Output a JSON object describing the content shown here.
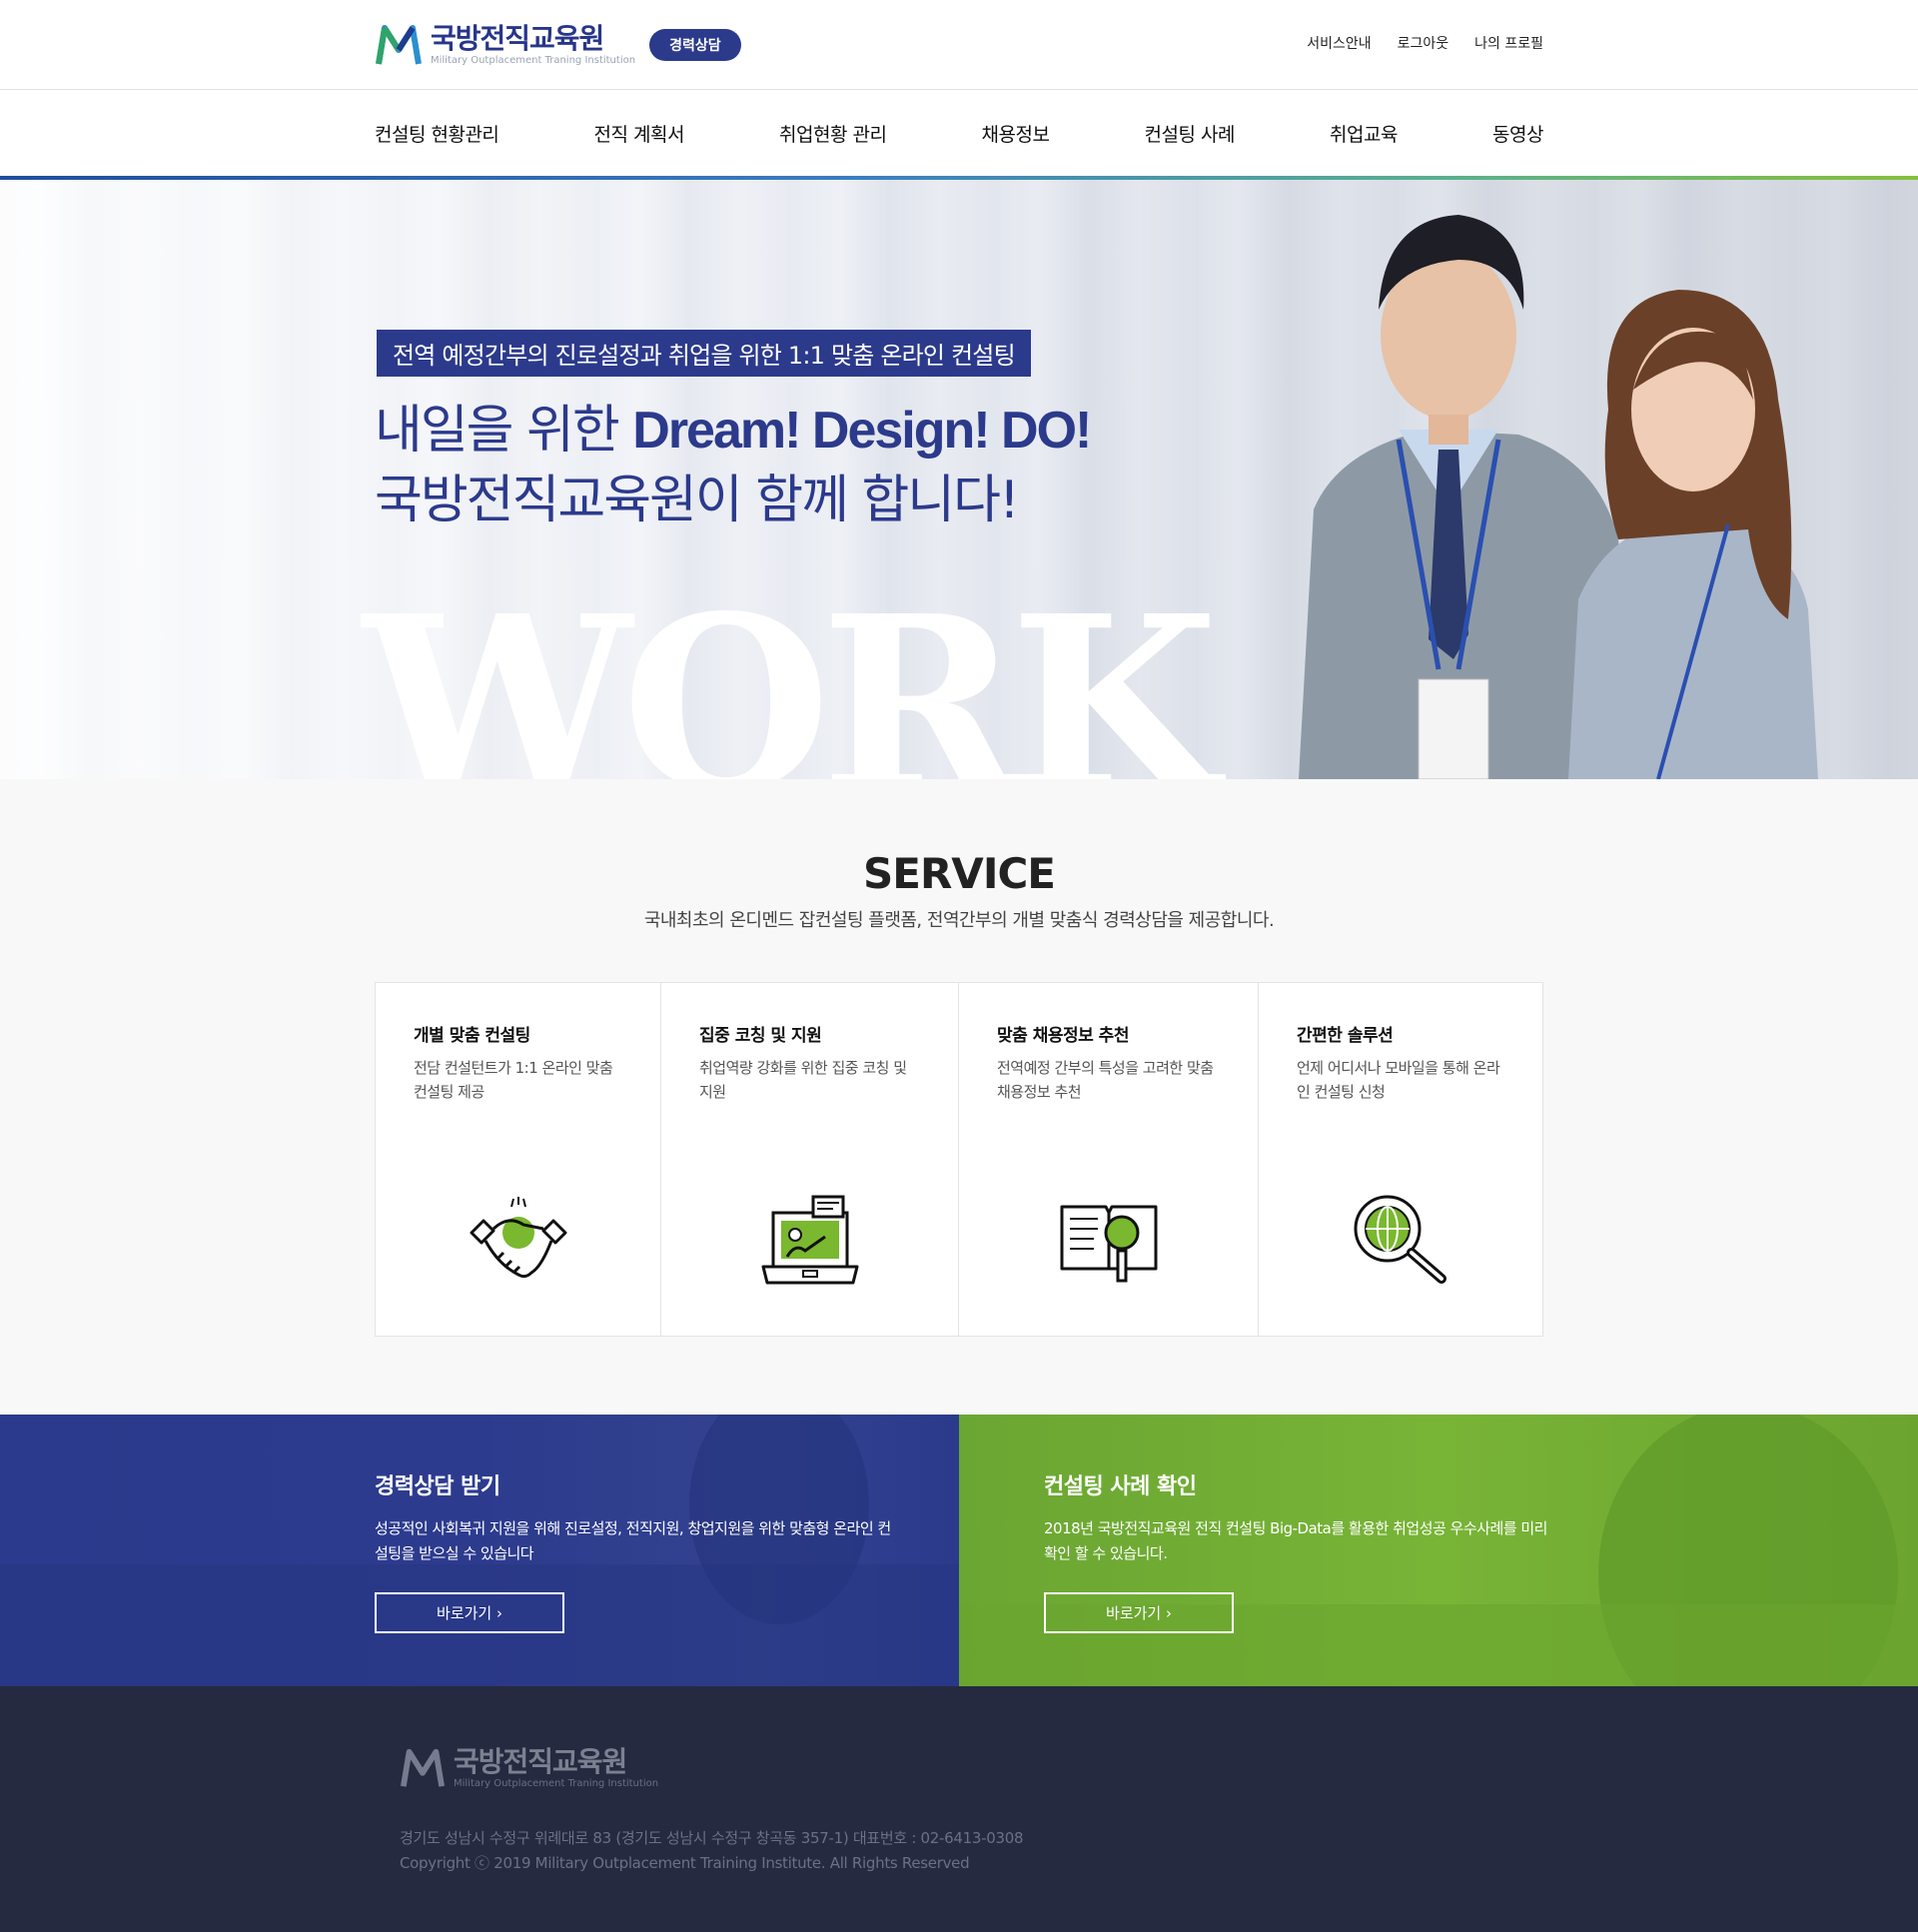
{
  "header": {
    "logo_ko": "국방전직교육원",
    "logo_en": "Military Outplacement Traning Institution",
    "badge": "경력상담",
    "util": [
      "서비스안내",
      "로그아웃",
      "나의 프로필"
    ]
  },
  "nav": {
    "items": [
      "컨설팅 현황관리",
      "전직 계획서",
      "취업현황 관리",
      "채용정보",
      "컨설팅 사례",
      "취업교육",
      "동영상"
    ]
  },
  "hero": {
    "tag": "전역 예정간부의 진로설정과 취업을 위한 1:1 맞춤 온라인 컨설팅",
    "line1_ko": "내일을 위한 ",
    "line1_en": "Dream! Design! DO!",
    "line2": "국방전직교육원이 함께 합니다!",
    "bg_word": "WORK"
  },
  "service": {
    "title": "SERVICE",
    "subtitle": "국내최초의 온디멘드 잡컨설팅 플랫폼, 전역간부의 개별 맞춤식 경력상담을 제공합니다.",
    "cards": [
      {
        "title": "개별 맞춤 컨설팅",
        "desc": "전담 컨설턴트가 1:1 온라인 맞춤 컨설팅 제공",
        "icon": "handshake-icon"
      },
      {
        "title": "집중 코칭 및 지원",
        "desc": "취업역량 강화를 위한 집중 코칭 및 지원",
        "icon": "laptop-coaching-icon"
      },
      {
        "title": "맞춤 채용정보 추천",
        "desc": "전역예정 간부의 특성을 고려한 맞춤 채용정보 추천",
        "icon": "book-search-icon"
      },
      {
        "title": "간편한 솔루션",
        "desc": "언제 어디서나 모바일을 통해 온라인 컨설팅 신청",
        "icon": "globe-magnifier-icon"
      }
    ]
  },
  "banners": {
    "left": {
      "title": "경력상담 받기",
      "desc": "성공적인 사회복귀 지원을 위해 진로설정, 전직지원, 창업지원을 위한 맞춤형 온라인 컨설팅을 받으실 수 있습니다",
      "button": "바로가기 ›"
    },
    "right": {
      "title": "컨설팅 사례 확인",
      "desc": "2018년 국방전직교육원 전직 컨설팅 Big-Data를 활용한  취업성공 우수사례를 미리 확인 할 수 있습니다.",
      "button": "바로가기 ›"
    }
  },
  "footer": {
    "logo_ko": "국방전직교육원",
    "logo_en": "Military Outplacement Traning Institution",
    "address": "경기도 성남시 수정구 위례대로 83 (경기도 성남시 수정구 창곡동 357-1)  대표번호 : 02-6413-0308",
    "copyright": "Copyright ⓒ 2019 Military Outplacement Training Institute. All Rights Reserved"
  },
  "colors": {
    "brand_navy": "#2c3a8c",
    "brand_green": "#76b235",
    "footer_bg": "#252a40"
  }
}
